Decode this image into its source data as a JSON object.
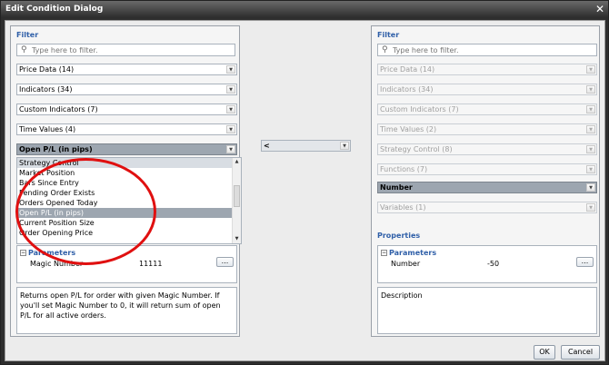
{
  "window": {
    "title": "Edit Condition Dialog",
    "close_glyph": "✕"
  },
  "left": {
    "filter_label": "Filter",
    "filter_placeholder": "Type here to filter.",
    "combos": [
      "Price Data (14)",
      "Indicators (34)",
      "Custom Indicators (7)",
      "Time Values (4)"
    ],
    "selected_combo": "Open P/L (in pips)",
    "list_items": [
      "Strategy Control",
      "Market Position",
      "Bars Since Entry",
      "Pending Order Exists",
      "Orders Opened Today",
      "Open P/L (in pips)",
      "Current Position Size",
      "Order Opening Price"
    ],
    "parameters": {
      "category": "Parameters",
      "name": "Magic Number",
      "value": "11111",
      "browse": "..."
    },
    "description": "Returns open P/L for order with given Magic Number. If you'll set Magic Number to 0, it will return sum of open P/L for all active orders."
  },
  "operator": {
    "value": "<"
  },
  "right": {
    "filter_label": "Filter",
    "filter_placeholder": "Type here to filter.",
    "combos": [
      "Price Data (14)",
      "Indicators (34)",
      "Custom Indicators (7)",
      "Time Values (2)",
      "Strategy Control (8)",
      "Functions (7)"
    ],
    "selected_combo": "Number",
    "combo_after": "Variables (1)",
    "properties_label": "Properties",
    "parameters": {
      "category": "Parameters",
      "name": "Number",
      "value": "-50",
      "browse": "..."
    },
    "description": "Description"
  },
  "buttons": {
    "ok": "OK",
    "cancel": "Cancel"
  },
  "icons": {
    "filter": "search-icon",
    "expand": "minus-box-icon",
    "dropdown": "chevron-down-icon"
  }
}
